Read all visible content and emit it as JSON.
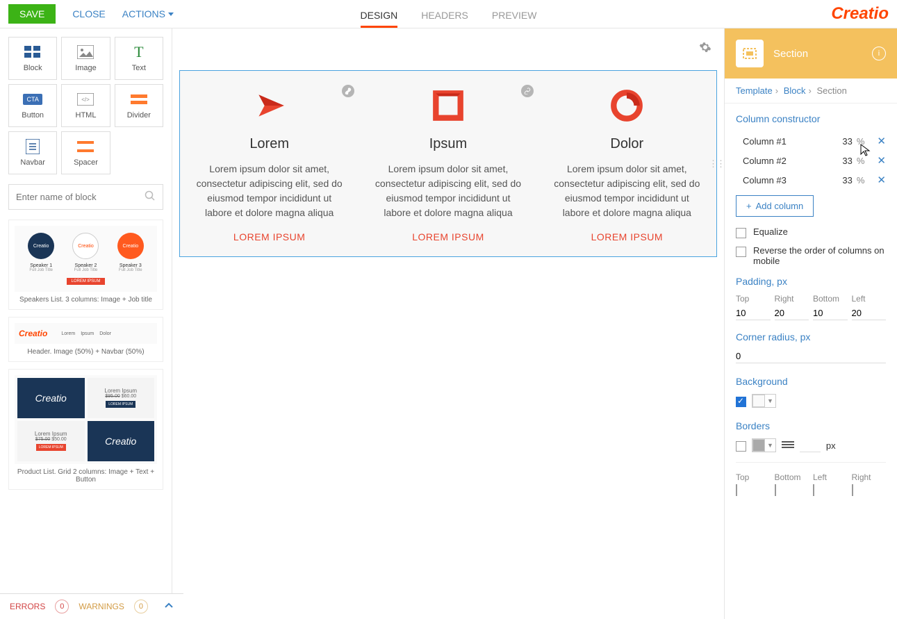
{
  "topbar": {
    "save": "SAVE",
    "close": "CLOSE",
    "actions": "ACTIONS"
  },
  "tabs": {
    "design": "DESIGN",
    "headers": "HEADERS",
    "preview": "PREVIEW"
  },
  "brand": "Creatio",
  "elements": [
    {
      "label": "Block"
    },
    {
      "label": "Image"
    },
    {
      "label": "Text"
    },
    {
      "label": "Button"
    },
    {
      "label": "HTML"
    },
    {
      "label": "Divider"
    },
    {
      "label": "Navbar"
    },
    {
      "label": "Spacer"
    }
  ],
  "search": {
    "placeholder": "Enter name of block"
  },
  "presets": {
    "speakers": {
      "caption": "Speakers List. 3 columns: Image + Job title",
      "s1": "Speaker 1",
      "s2": "Speaker 2",
      "s3": "Speaker 3",
      "sub": "Full Job Title",
      "btn": "LOREM IPSUM"
    },
    "header": {
      "caption": "Header. Image (50%) + Navbar (50%)",
      "nav": [
        "Lorem",
        "Ipsum",
        "Dolor"
      ]
    },
    "product": {
      "caption": "Product List. Grid 2 columns: Image + Text + Button",
      "title": "Lorem Ipsum",
      "price1": "$95.00",
      "price2": "$60.00",
      "price3": "$75.00",
      "price4": "$50.00",
      "btn": "LOREM IPSUM"
    }
  },
  "canvas": {
    "cols": [
      {
        "title": "Lorem",
        "text": "Lorem ipsum dolor sit amet, consectetur adipiscing elit, sed do eiusmod tempor incididunt ut labore et dolore magna aliqua",
        "cta": "LOREM IPSUM"
      },
      {
        "title": "Ipsum",
        "text": "Lorem ipsum dolor sit amet, consectetur adipiscing elit, sed do eiusmod tempor incididunt ut labore et dolore magna aliqua",
        "cta": "LOREM IPSUM"
      },
      {
        "title": "Dolor",
        "text": "Lorem ipsum dolor sit amet, consectetur adipiscing elit, sed do eiusmod tempor incididunt ut labore et dolore magna aliqua",
        "cta": "LOREM IPSUM"
      }
    ]
  },
  "panel": {
    "title": "Section",
    "breadcrumbs": {
      "template": "Template",
      "block": "Block",
      "section": "Section"
    },
    "colCon": {
      "label": "Column constructor",
      "cols": [
        {
          "name": "Column #1",
          "val": "33",
          "pct": "%"
        },
        {
          "name": "Column #2",
          "val": "33",
          "pct": "%"
        },
        {
          "name": "Column #3",
          "val": "33",
          "pct": "%"
        }
      ],
      "add": "Add column",
      "equalize": "Equalize",
      "reverse": "Reverse the order of columns on mobile"
    },
    "padding": {
      "label": "Padding, px",
      "top": "Top",
      "right": "Right",
      "bottom": "Bottom",
      "left": "Left",
      "vtop": "10",
      "vright": "20",
      "vbottom": "10",
      "vleft": "20"
    },
    "corner": {
      "label": "Corner radius, px",
      "val": "0"
    },
    "bg": {
      "label": "Background"
    },
    "borders": {
      "label": "Borders",
      "px": "px"
    },
    "sides": {
      "top": "Top",
      "bottom": "Bottom",
      "left": "Left",
      "right": "Right"
    }
  },
  "footer": {
    "errors": "ERRORS",
    "errCount": "0",
    "warnings": "WARNINGS",
    "warnCount": "0"
  }
}
